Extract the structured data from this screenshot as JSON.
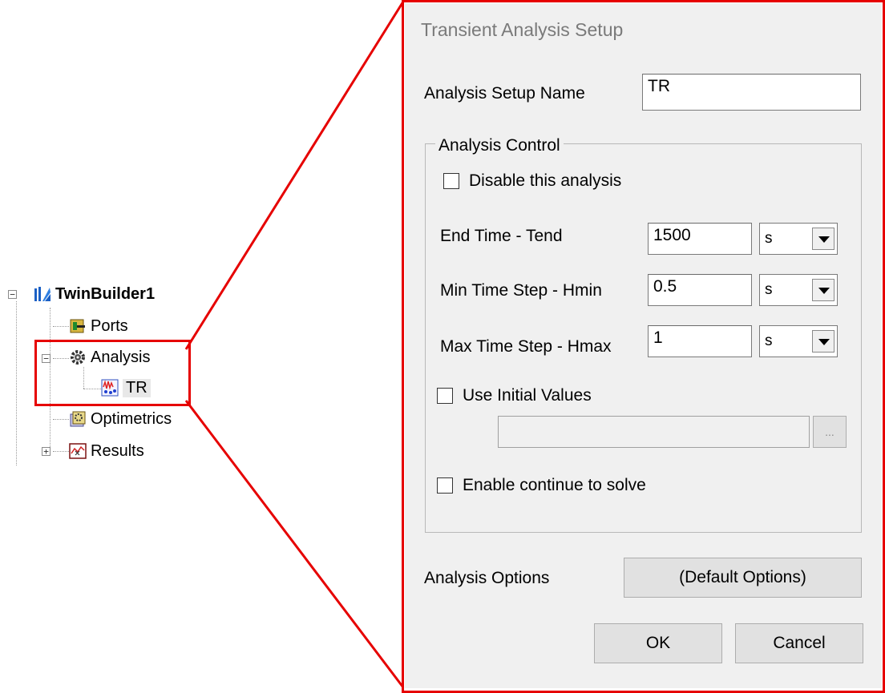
{
  "tree": {
    "root_label": "TwinBuilder1",
    "items": [
      {
        "label": "Ports"
      },
      {
        "label": "Analysis"
      },
      {
        "label": "TR"
      },
      {
        "label": "Optimetrics"
      },
      {
        "label": "Results"
      }
    ],
    "expanders": {
      "root": "−",
      "analysis": "−",
      "results": "+"
    }
  },
  "dialog": {
    "title": "Transient Analysis Setup",
    "setup_name_label": "Analysis Setup Name",
    "setup_name_value": "TR",
    "group_label": "Analysis Control",
    "disable_label": "Disable this analysis",
    "end_time_label": "End Time - Tend",
    "end_time_value": "1500",
    "end_time_unit": "s",
    "min_step_label": "Min Time Step - Hmin",
    "min_step_value": "0.5",
    "min_step_unit": "s",
    "max_step_label": "Max Time Step - Hmax",
    "max_step_value": "1",
    "max_step_unit": "s",
    "initial_values_label": "Use Initial Values",
    "initial_values_value": "",
    "browse_label": "...",
    "continue_label": "Enable continue to solve",
    "options_label": "Analysis Options",
    "options_button": "(Default Options)",
    "ok_button": "OK",
    "cancel_button": "Cancel"
  },
  "colors": {
    "highlight": "#e60000",
    "dialog_bg": "#f0f0f0"
  }
}
